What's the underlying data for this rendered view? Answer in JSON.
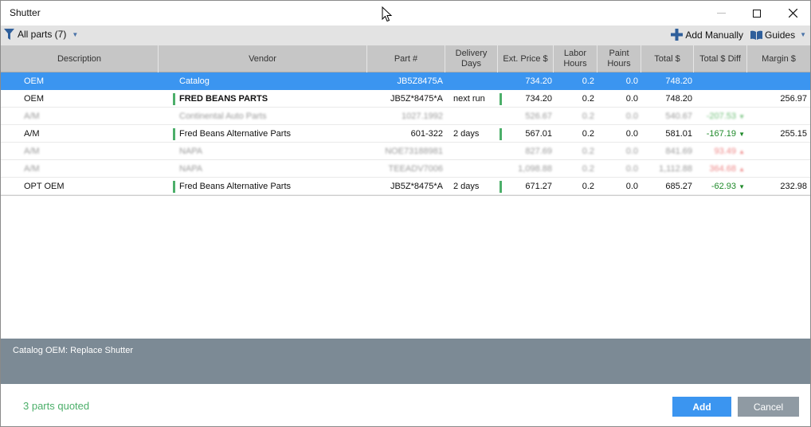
{
  "window": {
    "title": "Shutter"
  },
  "toolbar": {
    "filter_label": "All parts (7)",
    "add_manually_label": "Add Manually",
    "guides_label": "Guides"
  },
  "columns": [
    "Description",
    "Vendor",
    "Part #",
    "Delivery Days",
    "Ext. Price $",
    "Labor Hours",
    "Paint Hours",
    "Total $",
    "Total $ Diff",
    "Margin $"
  ],
  "rows": [
    {
      "desc": "OEM",
      "vendor": "Catalog",
      "part": "JB5Z8475A",
      "delivery": "",
      "ext": "734.20",
      "labor": "0.2",
      "paint": "0.0",
      "total": "748.20",
      "diff": "",
      "margin": ""
    },
    {
      "desc": "OEM",
      "vendor": "FRED BEANS PARTS",
      "part": "JB5Z*8475*A",
      "delivery": "next run",
      "ext": "734.20",
      "labor": "0.2",
      "paint": "0.0",
      "total": "748.20",
      "diff": "",
      "margin": "256.97"
    },
    {
      "desc": "A/M",
      "vendor": "Continental Auto Parts",
      "part": "1027.1992",
      "delivery": "",
      "ext": "526.67",
      "labor": "0.2",
      "paint": "0.0",
      "total": "540.67",
      "diff": "-207.53",
      "margin": ""
    },
    {
      "desc": "A/M",
      "vendor": "Fred Beans Alternative Parts",
      "part": "601-322",
      "delivery": "2 days",
      "ext": "567.01",
      "labor": "0.2",
      "paint": "0.0",
      "total": "581.01",
      "diff": "-167.19",
      "margin": "255.15"
    },
    {
      "desc": "A/M",
      "vendor": "NAPA",
      "part": "NOE73188981",
      "delivery": "",
      "ext": "827.69",
      "labor": "0.2",
      "paint": "0.0",
      "total": "841.69",
      "diff": "93.49",
      "margin": ""
    },
    {
      "desc": "A/M",
      "vendor": "NAPA",
      "part": "TEEADV7006",
      "delivery": "",
      "ext": "1,098.88",
      "labor": "0.2",
      "paint": "0.0",
      "total": "1,112.88",
      "diff": "364.68",
      "margin": ""
    },
    {
      "desc": "OPT OEM",
      "vendor": "Fred Beans Alternative Parts",
      "part": "JB5Z*8475*A",
      "delivery": "2 days",
      "ext": "671.27",
      "labor": "0.2",
      "paint": "0.0",
      "total": "685.27",
      "diff": "-62.93",
      "margin": "232.98"
    }
  ],
  "info_panel": {
    "text": "Catalog OEM: Replace Shutter"
  },
  "footer": {
    "status": "3 parts quoted",
    "add_label": "Add",
    "cancel_label": "Cancel"
  },
  "colors": {
    "accent": "#3b95f0",
    "positive": "#1f8a2a",
    "negative": "#d23a3a",
    "vendor_bar": "#4caf6a",
    "panel": "#7c8a95"
  }
}
